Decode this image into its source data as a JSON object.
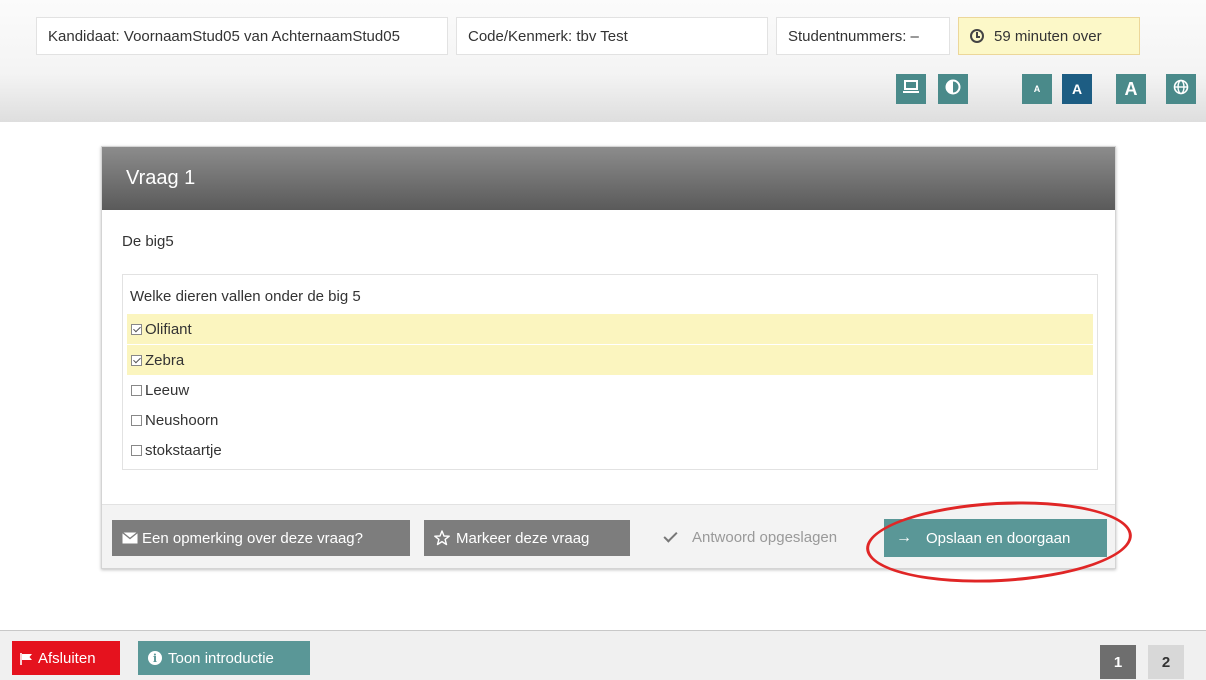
{
  "header": {
    "candidate": "Kandidaat: VoornaamStud05 van AchternaamStud05",
    "code": "Code/Kenmerk: tbv Test",
    "student_numbers": "Studentnummers: –",
    "timer": "59 minuten over"
  },
  "toolbar": {
    "font_small": "A",
    "font_medium": "A",
    "font_large": "A"
  },
  "question": {
    "title": "Vraag 1",
    "intro": "De big5",
    "text": "Welke dieren vallen onder de big 5",
    "options": [
      {
        "label": "Olifiant",
        "checked": true
      },
      {
        "label": "Zebra",
        "checked": true
      },
      {
        "label": "Leeuw",
        "checked": false
      },
      {
        "label": "Neushoorn",
        "checked": false
      },
      {
        "label": "stokstaartje",
        "checked": false
      }
    ]
  },
  "footer": {
    "remark_label": "Een opmerking over deze vraag?",
    "mark_label": "Markeer deze vraag",
    "saved_status": "Antwoord opgeslagen",
    "continue_label": "Opslaan en doorgaan"
  },
  "bottombar": {
    "exit_label": "Afsluiten",
    "intro_label": "Toon introductie",
    "pages": [
      "1",
      "2"
    ]
  },
  "colors": {
    "accent": "#5a9797",
    "active_tool": "#1d5d83",
    "danger": "#e5121e",
    "selected_option": "#fbf5bf",
    "annotation": "#e02626"
  }
}
